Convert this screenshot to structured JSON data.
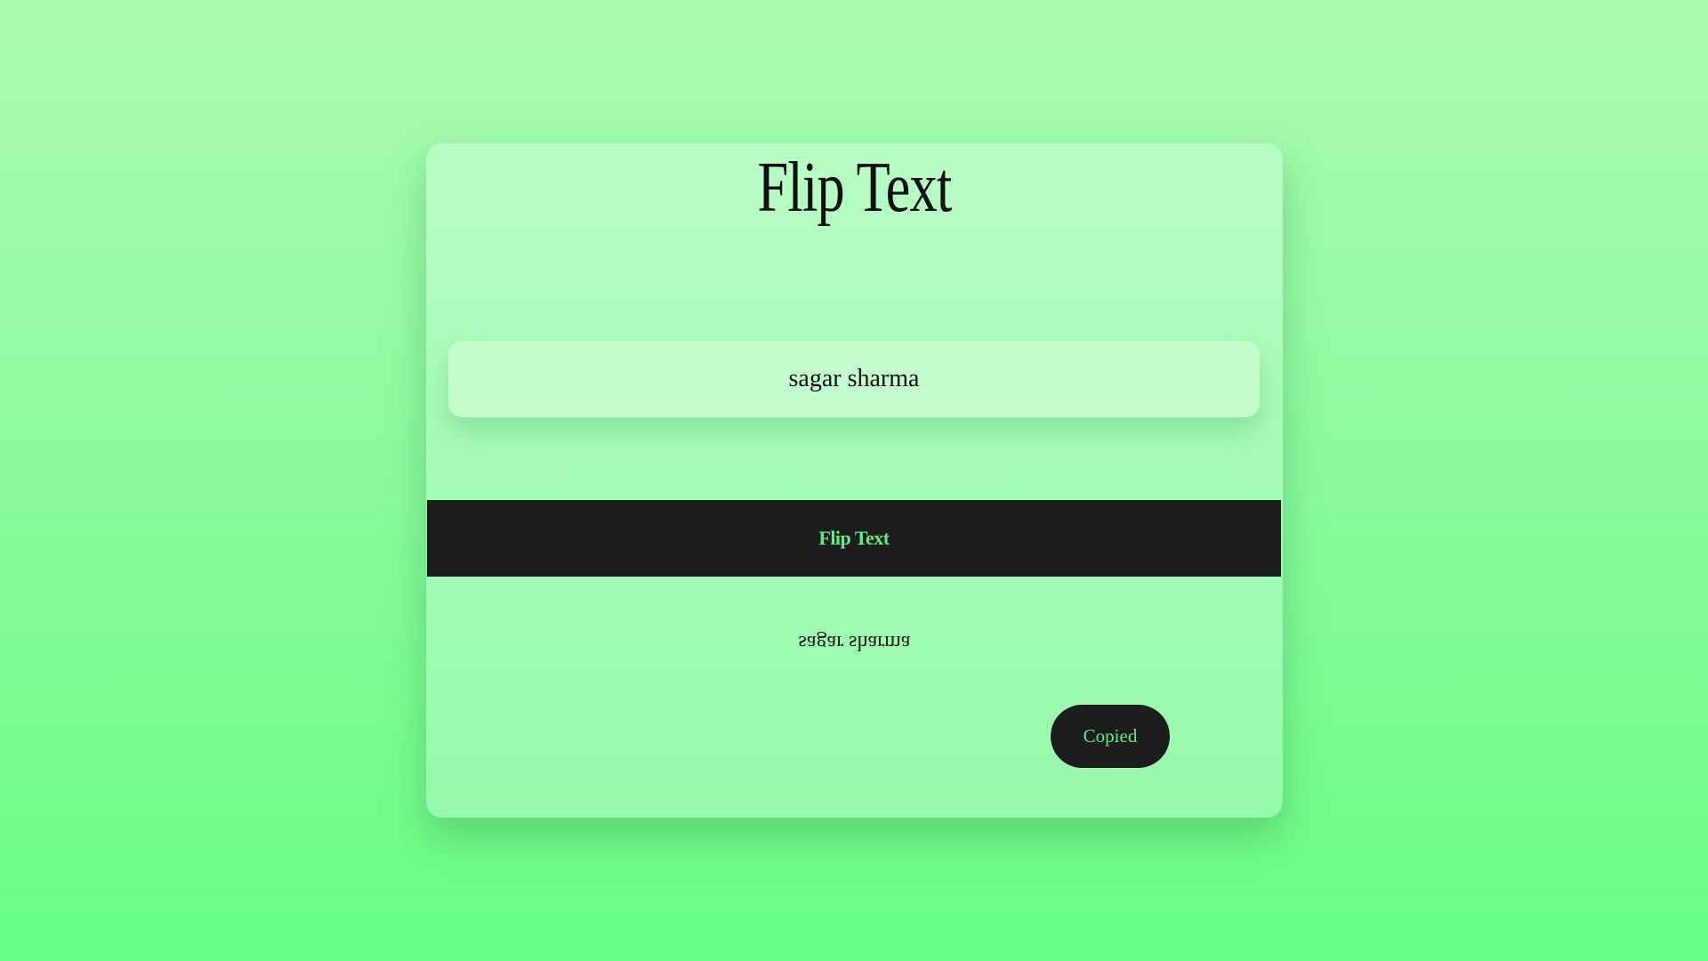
{
  "app": {
    "title": "Flip Text"
  },
  "input": {
    "value": "sagar sharma",
    "placeholder": ""
  },
  "flip_button": {
    "label": "Flip Text"
  },
  "output": {
    "text": "sagar sharma"
  },
  "copy_button": {
    "label": "Copied"
  },
  "colors": {
    "background_top": "#aafcb0",
    "background_bottom": "#67fd82",
    "button_bg": "#1d1d1d",
    "button_text": "#5af07d"
  }
}
